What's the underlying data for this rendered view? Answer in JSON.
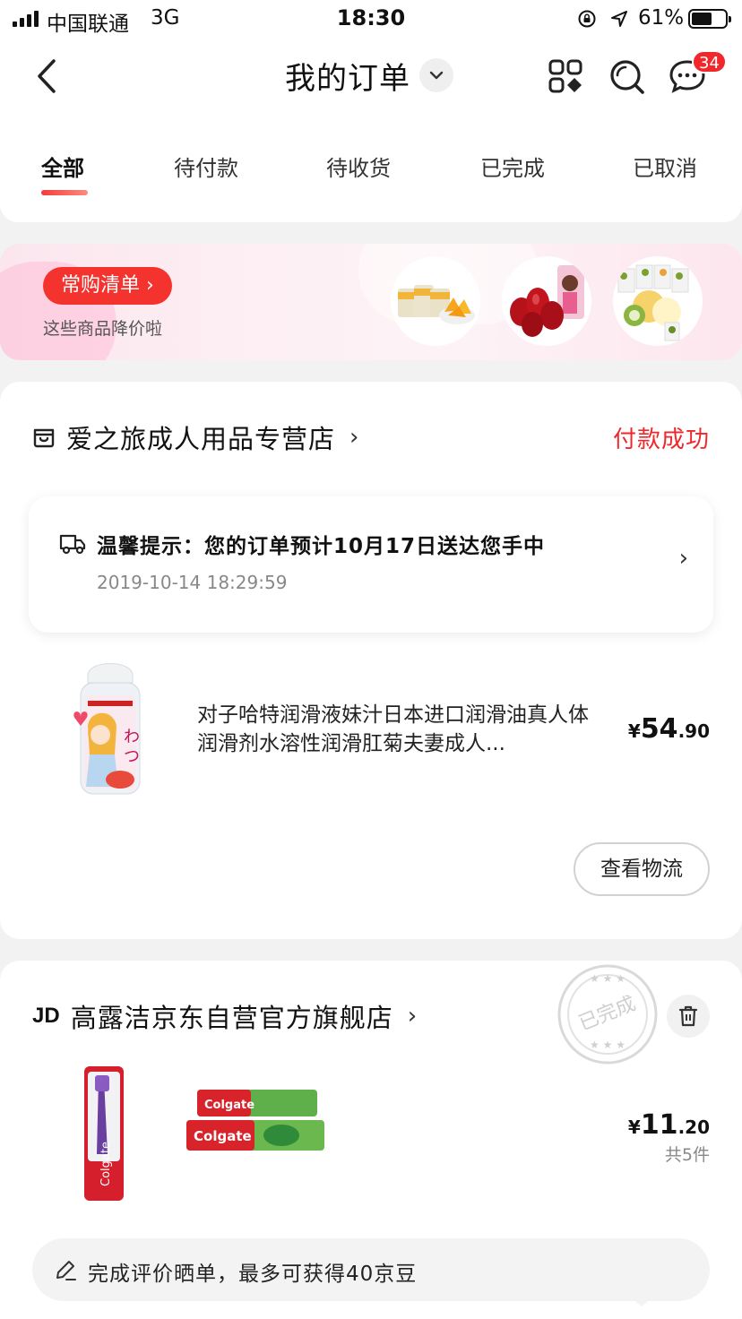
{
  "status_bar": {
    "carrier": "中国联通",
    "network": "3G",
    "time": "18:30",
    "battery": "61%",
    "battery_level": 0.61
  },
  "header": {
    "title": "我的订单",
    "message_badge": "34",
    "icons": [
      "back-icon",
      "chevron-down-icon",
      "category-grid-icon",
      "search-icon",
      "message-icon"
    ]
  },
  "tabs": [
    "全部",
    "待付款",
    "待收货",
    "已完成",
    "已取消"
  ],
  "active_tab": 0,
  "promo": {
    "button_label": "常购清单 ›",
    "subtitle": "这些商品降价啦"
  },
  "orders": [
    {
      "store_name": "爱之旅成人用品专营店",
      "store_arrow": "›",
      "status": "付款成功",
      "tip": {
        "title": "温馨提示：您的订单预计10月17日送达您手中",
        "time": "2019-10-14 18:29:59",
        "arrow": "›"
      },
      "product_title": "对子哈特润滑液妹汁日本进口润滑油真人体润滑剂水溶性润滑肛菊夫妻成人...",
      "price_currency": "¥",
      "price_int": "54",
      "price_dec": ".90",
      "action_button": "查看物流"
    },
    {
      "store_logo": "JD",
      "store_name": "高露洁京东自营官方旗舰店",
      "store_arrow": "›",
      "stamp": "已完成",
      "price_currency": "¥",
      "price_int": "11",
      "price_dec": ".20",
      "quantity": "共5件",
      "review_prompt": "完成评价晒单，最多可获得40京豆"
    }
  ],
  "colors": {
    "accent_red": "#f0272b",
    "promo_button": "#f4322e",
    "page_bg": "#f2f2f2"
  }
}
